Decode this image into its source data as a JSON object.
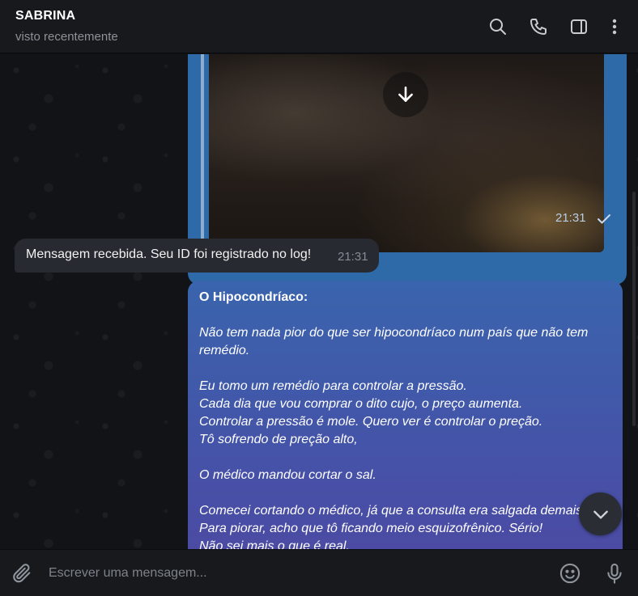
{
  "header": {
    "name": "SABRINA",
    "status": "visto recentemente"
  },
  "media_message": {
    "time": "21:31"
  },
  "incoming_message": {
    "text": "Mensagem recebida. Seu ID foi registrado no log!",
    "time": "21:31"
  },
  "outgoing_message": {
    "title": "O Hipocondríaco:",
    "lines": [
      "Não tem nada pior do que ser hipocondríaco num país que não tem",
      "remédio.",
      "",
      "Eu tomo um remédio para controlar a pressão.",
      "Cada dia que vou comprar o dito cujo, o preço aumenta.",
      "Controlar a pressão é mole. Quero ver é controlar o preção.",
      "Tô sofrendo de preção alto,",
      "",
      "O médico mandou cortar o sal.",
      "",
      "Comecei cortando o médico, já que a consulta era salgada demais.",
      "Para piorar, acho que tô ficando meio esquizofrênico. Sério!",
      "Não sei mais o que é real."
    ]
  },
  "composer": {
    "placeholder": "Escrever uma mensagem..."
  },
  "colors": {
    "header_bg": "#17191d",
    "outgoing_bubble": "#3a64ad",
    "incoming_bubble": "#272a30",
    "secondary_text": "#8c9298"
  },
  "icons": {
    "search": "search-icon",
    "call": "phone-icon",
    "sidebar": "sidebar-toggle-icon",
    "more": "more-vertical-icon",
    "attach": "paperclip-icon",
    "emoji": "emoji-icon",
    "mic": "microphone-icon",
    "download": "download-arrow-icon",
    "scroll_down": "chevron-down-icon",
    "read": "check-icon"
  }
}
